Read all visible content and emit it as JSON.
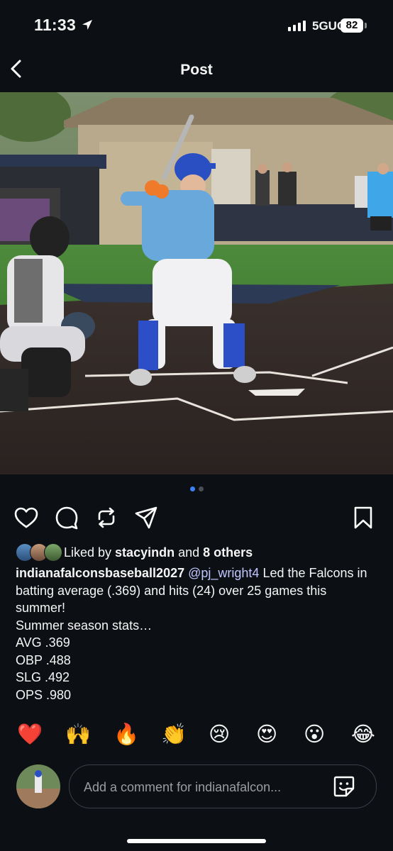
{
  "status": {
    "time": "11:33",
    "network": "5GUC",
    "battery": "82"
  },
  "header": {
    "title": "Post"
  },
  "post": {
    "liked_prefix": "Liked by ",
    "liked_user": "stacyindn",
    "liked_mid": " and ",
    "liked_others": "8 others",
    "caption_user": "indianafalconsbaseball2027",
    "caption_mention": "@pj_wright4",
    "caption_text": "  Led the Falcons in batting average (.369) and hits (24) over 25 games this summer!",
    "caption_lines": [
      "Summer season stats…",
      "AVG .369",
      "OBP .488",
      "SLG .492",
      "OPS .980"
    ],
    "carousel": {
      "count": 2,
      "active": 0
    }
  },
  "reactions": [
    "❤️",
    "🙌",
    "🔥",
    "👏",
    "😢",
    "😍",
    "😮",
    "😂"
  ],
  "comment": {
    "placeholder": "Add a comment for indianafalcon..."
  },
  "colors": {
    "background": "#0c1014",
    "accent": "#3b82f6",
    "mention": "#c0c7ff"
  }
}
